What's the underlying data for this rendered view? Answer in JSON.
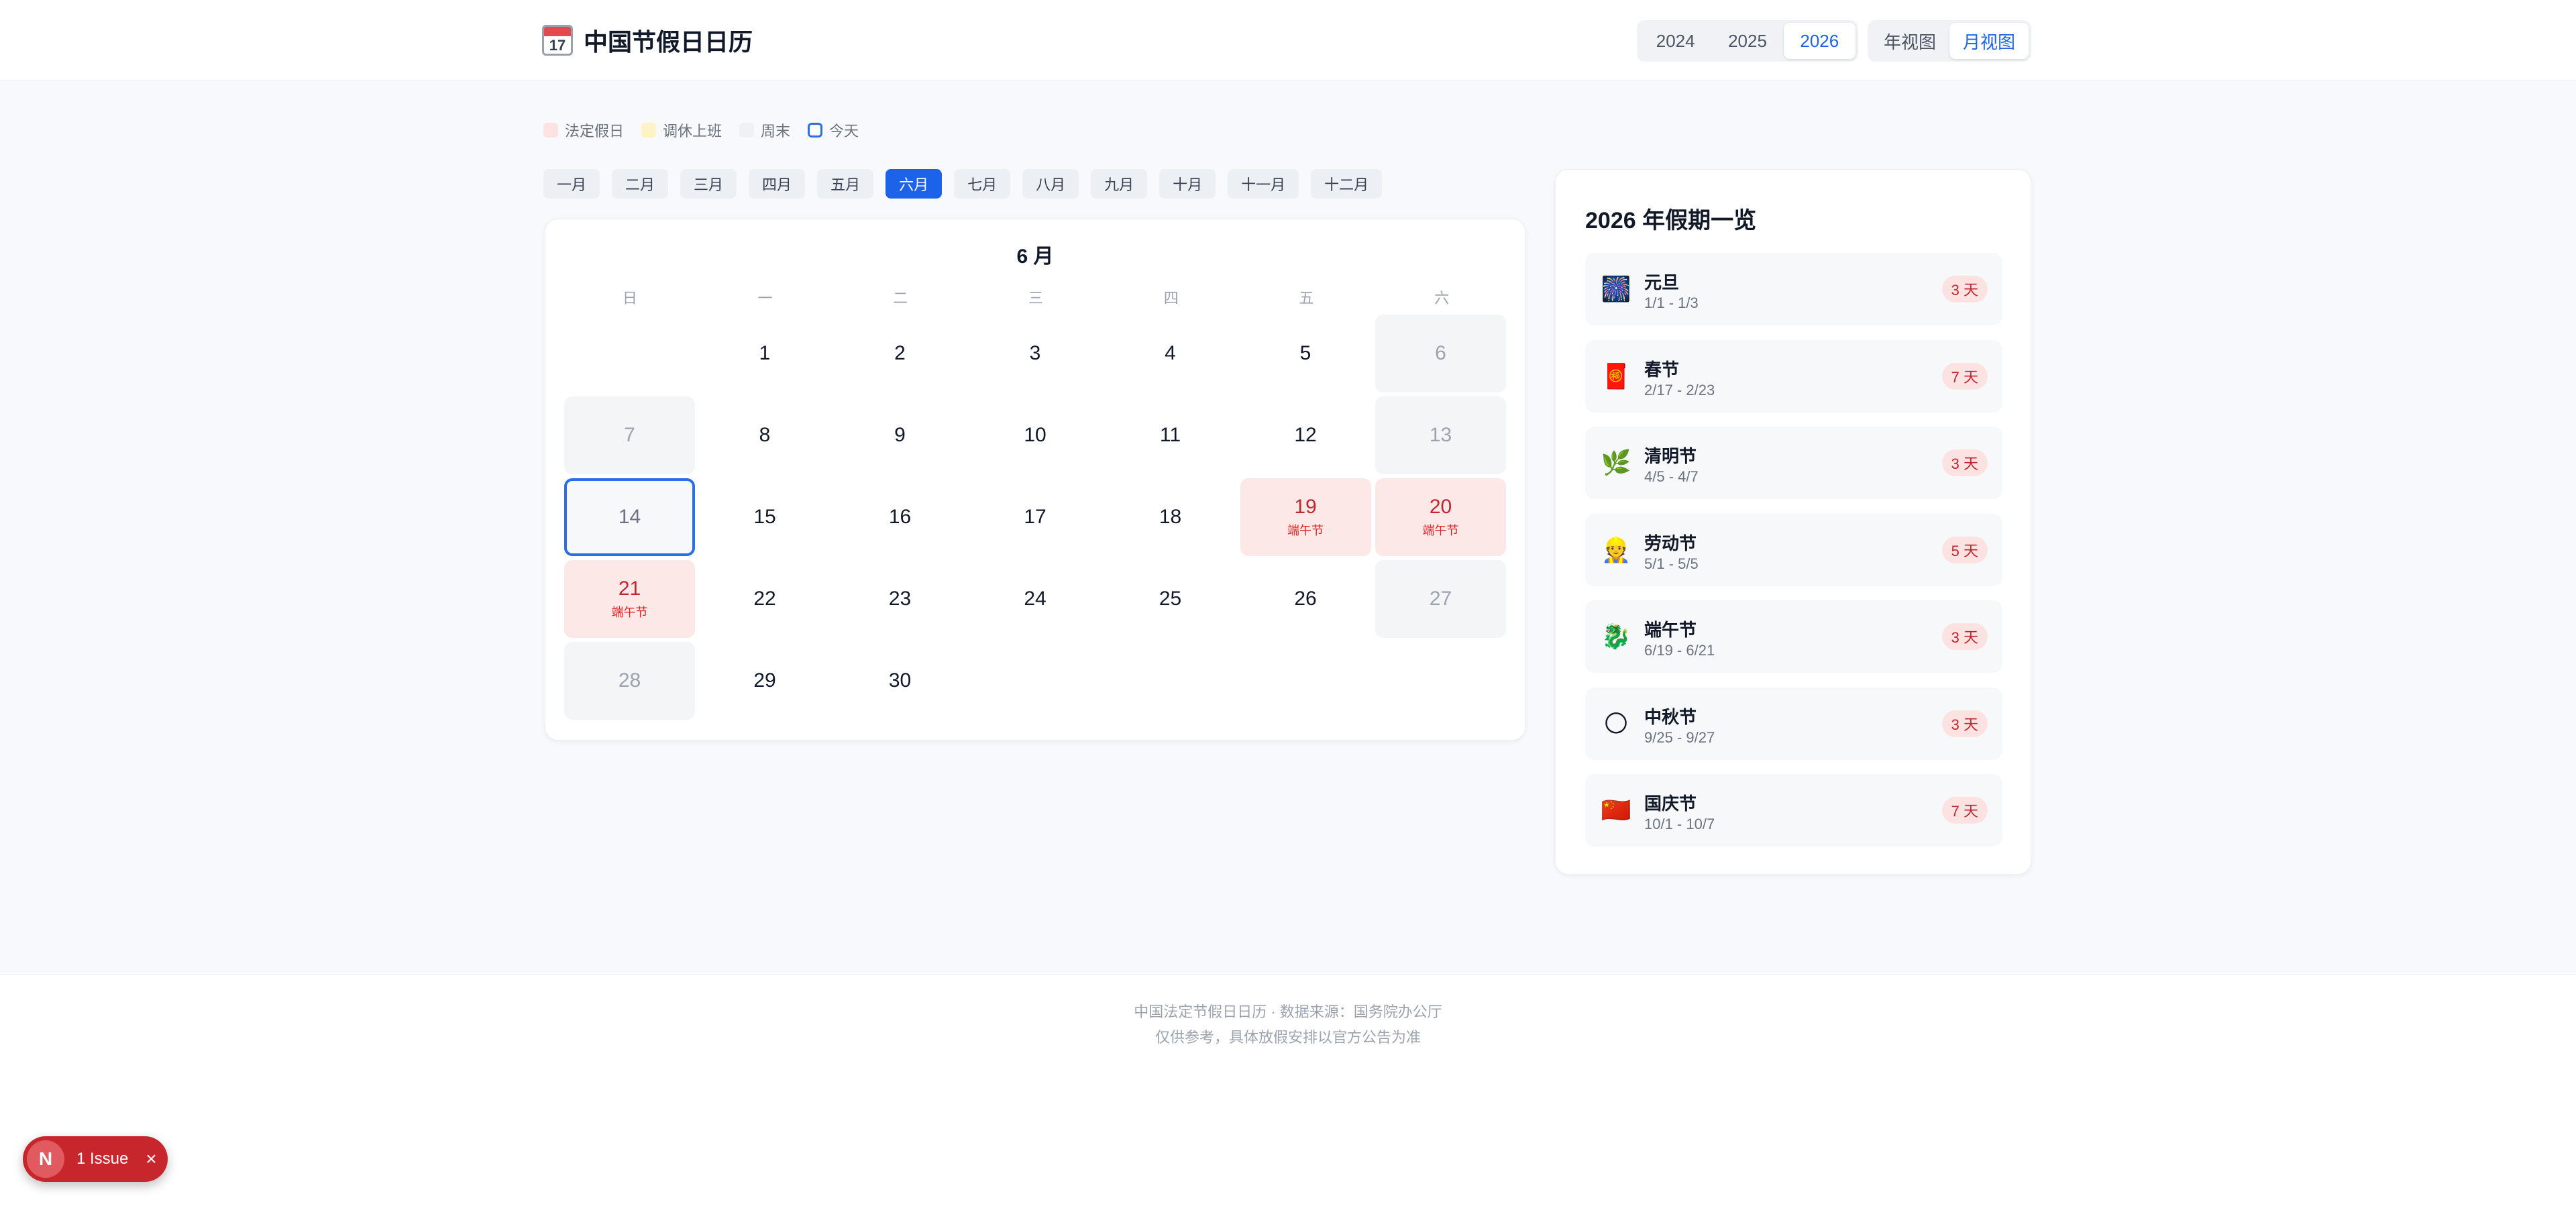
{
  "header": {
    "icon_number": "17",
    "title": "中国节假日日历",
    "years": [
      "2024",
      "2025",
      "2026"
    ],
    "active_year": "2026",
    "views": [
      "年视图",
      "月视图"
    ],
    "active_view": "月视图"
  },
  "legend": [
    {
      "label": "法定假日",
      "color": "#fde2e2",
      "border": "#fde2e2"
    },
    {
      "label": "调休上班",
      "color": "#fef3c7",
      "border": "#fef3c7"
    },
    {
      "label": "周末",
      "color": "#eef1f5",
      "border": "#eef1f5"
    },
    {
      "label": "今天",
      "color": "#ffffff",
      "border": "#2a6fe8"
    }
  ],
  "months": [
    "一月",
    "二月",
    "三月",
    "四月",
    "五月",
    "六月",
    "七月",
    "八月",
    "九月",
    "十月",
    "十一月",
    "十二月"
  ],
  "active_month": "六月",
  "calendar": {
    "title": "6 月",
    "weekdays": [
      "日",
      "一",
      "二",
      "三",
      "四",
      "五",
      "六"
    ],
    "leading_blanks": 1,
    "days": [
      {
        "d": "1",
        "type": "normal"
      },
      {
        "d": "2",
        "type": "normal"
      },
      {
        "d": "3",
        "type": "normal"
      },
      {
        "d": "4",
        "type": "normal"
      },
      {
        "d": "5",
        "type": "normal"
      },
      {
        "d": "6",
        "type": "weekend"
      },
      {
        "d": "7",
        "type": "weekend"
      },
      {
        "d": "8",
        "type": "normal"
      },
      {
        "d": "9",
        "type": "normal"
      },
      {
        "d": "10",
        "type": "normal"
      },
      {
        "d": "11",
        "type": "normal"
      },
      {
        "d": "12",
        "type": "normal"
      },
      {
        "d": "13",
        "type": "weekend"
      },
      {
        "d": "14",
        "type": "today"
      },
      {
        "d": "15",
        "type": "normal"
      },
      {
        "d": "16",
        "type": "normal"
      },
      {
        "d": "17",
        "type": "normal"
      },
      {
        "d": "18",
        "type": "normal"
      },
      {
        "d": "19",
        "type": "holiday",
        "sub": "端午节"
      },
      {
        "d": "20",
        "type": "holiday",
        "sub": "端午节"
      },
      {
        "d": "21",
        "type": "holiday",
        "sub": "端午节"
      },
      {
        "d": "22",
        "type": "normal"
      },
      {
        "d": "23",
        "type": "normal"
      },
      {
        "d": "24",
        "type": "normal"
      },
      {
        "d": "25",
        "type": "normal"
      },
      {
        "d": "26",
        "type": "normal"
      },
      {
        "d": "27",
        "type": "weekend"
      },
      {
        "d": "28",
        "type": "weekend"
      },
      {
        "d": "29",
        "type": "normal"
      },
      {
        "d": "30",
        "type": "normal"
      }
    ]
  },
  "sidebar": {
    "title": "2026 年假期一览",
    "holidays": [
      {
        "icon": "fireworks-icon",
        "glyph": "🎆",
        "name": "元旦",
        "range": "1/1 - 1/3",
        "days": "3 天"
      },
      {
        "icon": "red-envelope-icon",
        "glyph": "🧧",
        "name": "春节",
        "range": "2/17 - 2/23",
        "days": "7 天"
      },
      {
        "icon": "herb-icon",
        "glyph": "🌿",
        "name": "清明节",
        "range": "4/5 - 4/7",
        "days": "3 天"
      },
      {
        "icon": "worker-icon",
        "glyph": "👷",
        "name": "劳动节",
        "range": "5/1 - 5/5",
        "days": "5 天"
      },
      {
        "icon": "dragon-icon",
        "glyph": "🐉",
        "name": "端午节",
        "range": "6/19 - 6/21",
        "days": "3 天"
      },
      {
        "icon": "moon-icon",
        "glyph": "🌕",
        "name": "中秋节",
        "range": "9/25 - 9/27",
        "days": "3 天"
      },
      {
        "icon": "china-flag-icon",
        "glyph": "🇨🇳",
        "name": "国庆节",
        "range": "10/1 - 10/7",
        "days": "7 天"
      }
    ]
  },
  "footer": {
    "line1": "中国法定节假日日历 · 数据来源：国务院办公厅",
    "line2": "仅供参考，具体放假安排以官方公告为准"
  },
  "issue_badge": {
    "letter": "N",
    "label": "1 Issue",
    "close": "×"
  }
}
